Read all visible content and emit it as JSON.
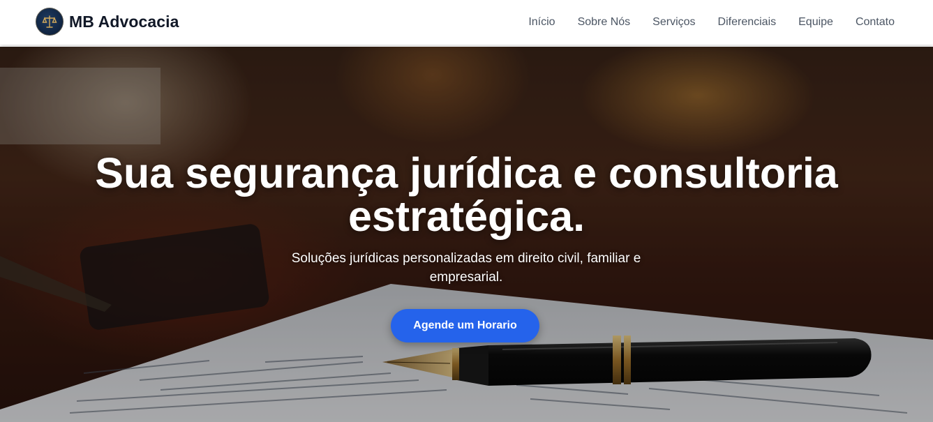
{
  "brand": {
    "name": "MB Advocacia",
    "logo_icon": "scales-of-justice-logo"
  },
  "nav": {
    "items": [
      "Início",
      "Sobre Nós",
      "Serviços",
      "Diferenciais",
      "Equipe",
      "Contato"
    ]
  },
  "hero": {
    "title_line1": "Sua segurança jurídica e consultoria",
    "title_line2": "estratégica.",
    "subtitle": "Soluções jurídicas personalizadas em direito civil, familiar e empresarial.",
    "cta_label": "Agende um Horario",
    "background_image": "desk-with-legal-document-and-fountain-pen"
  },
  "colors": {
    "accent": "#2563eb",
    "brand_text": "#111827",
    "nav_text": "#4b5563",
    "logo_bg": "#0f2340",
    "logo_gold": "#d4aa5a"
  }
}
